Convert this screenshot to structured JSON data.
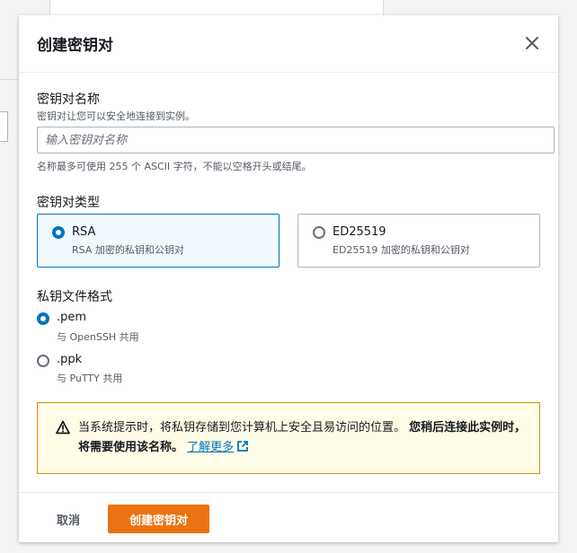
{
  "modal": {
    "title": "创建密钥对"
  },
  "name_field": {
    "label": "密钥对名称",
    "description": "密钥对让您可以安全地连接到实例。",
    "placeholder": "输入密钥对名称",
    "value": "",
    "constraint": "名称最多可使用 255 个 ASCII 字符，不能以空格开头或结尾。"
  },
  "key_type": {
    "label": "密钥对类型",
    "options": [
      {
        "title": "RSA",
        "description": "RSA 加密的私钥和公钥对",
        "selected": true
      },
      {
        "title": "ED25519",
        "description": "ED25519 加密的私钥和公钥对",
        "selected": false
      }
    ]
  },
  "file_format": {
    "label": "私钥文件格式",
    "options": [
      {
        "title": ".pem",
        "description": "与 OpenSSH 共用",
        "selected": true
      },
      {
        "title": ".ppk",
        "description": "与 PuTTY 共用",
        "selected": false
      }
    ]
  },
  "alert": {
    "text_part1": "当系统提示时，将私钥存储到您计算机上安全且易访问的位置。",
    "text_bold": "您稍后连接此实例时，将需要使用该名称。",
    "link_text": "了解更多",
    "icon": "warning-icon"
  },
  "footer": {
    "cancel_label": "取消",
    "create_label": "创建密钥对"
  },
  "colors": {
    "primary": "#ec7211",
    "selected_blue": "#0073bb",
    "warning_bg": "#fffce7",
    "warning_border": "#d09300"
  }
}
